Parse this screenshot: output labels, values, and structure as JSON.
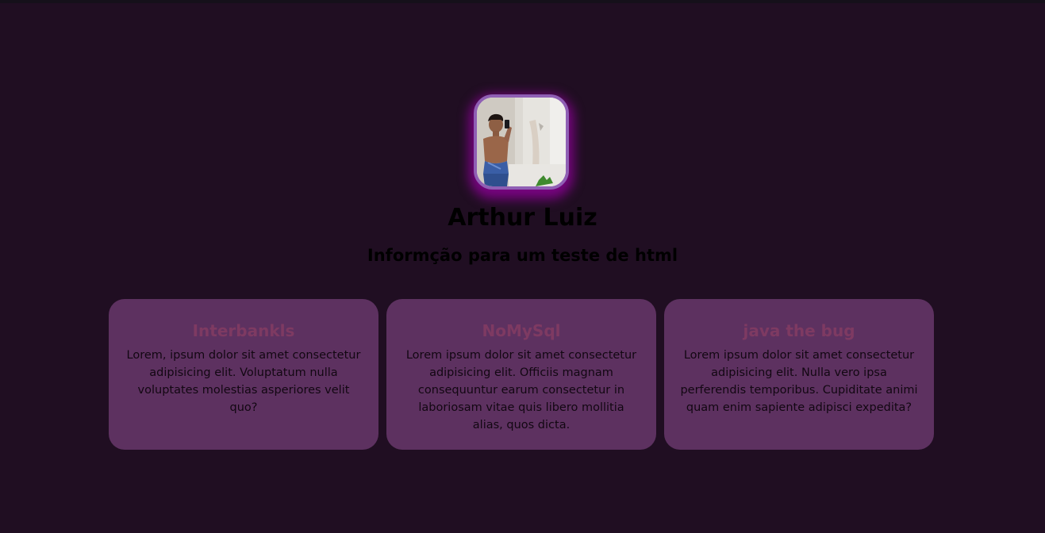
{
  "profile": {
    "name": "Arthur Luiz",
    "subtitle": "Informção para um teste de html",
    "avatar_border_color": "#8f5fb4",
    "avatar_glow_color": "#9600a0"
  },
  "cards": [
    {
      "title": "Interbankls",
      "text": "Lorem, ipsum dolor sit amet consectetur adipisicing elit. Voluptatum nulla voluptates molestias asperiores velit quo?"
    },
    {
      "title": "NoMySql",
      "text": "Lorem ipsum dolor sit amet consectetur adipisicing elit. Officiis magnam consequuntur earum consectetur in laboriosam vitae quis libero mollitia alias, quos dicta."
    },
    {
      "title": "java the bug",
      "text": "Lorem ipsum dolor sit amet consectetur adipisicing elit. Nulla vero ipsa perferendis temporibus. Cupiditate animi quam enim sapiente adipisci expedita?"
    }
  ],
  "colors": {
    "background": "#200e22",
    "card_background": "#5d3160",
    "card_title": "#7e3a62"
  }
}
